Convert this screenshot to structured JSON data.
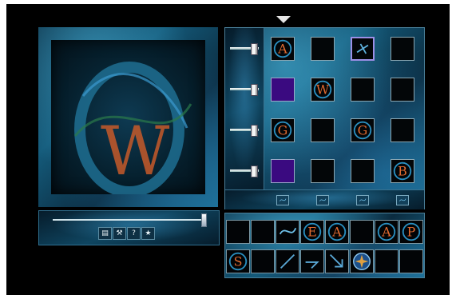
{
  "preview": {
    "letters": [
      "O",
      "W"
    ],
    "letter_colors": [
      "#1f6a8a",
      "#d86a32",
      "#3aa66a"
    ]
  },
  "playback": {
    "value": 1.0,
    "tools": [
      {
        "icon": "script-icon",
        "glyph": "▤"
      },
      {
        "icon": "hammer-icon",
        "glyph": "⚒"
      },
      {
        "icon": "help-icon",
        "glyph": "?"
      },
      {
        "icon": "star-icon",
        "glyph": "★"
      }
    ]
  },
  "grid": {
    "row_levels": [
      0.8,
      0.8,
      0.8,
      0.8
    ],
    "cells": [
      [
        "AK",
        "",
        "sel",
        ""
      ],
      [
        "purple",
        "W",
        "",
        ""
      ],
      [
        "G",
        "",
        "G2",
        ""
      ],
      [
        "purple",
        "",
        "",
        "B"
      ]
    ],
    "cell_letters": {
      "AK": "A",
      "W": "W",
      "G": "G",
      "G2": "G",
      "B": "B"
    }
  },
  "strip": {
    "row1": [
      "",
      "",
      "swirl",
      "E",
      "A",
      "",
      "A",
      "P"
    ],
    "row2": [
      "S",
      "",
      "slash",
      "hook",
      "arrow",
      "star",
      "",
      ""
    ],
    "letters": {
      "E": "E",
      "A": "A",
      "P": "P",
      "S": "S"
    }
  }
}
